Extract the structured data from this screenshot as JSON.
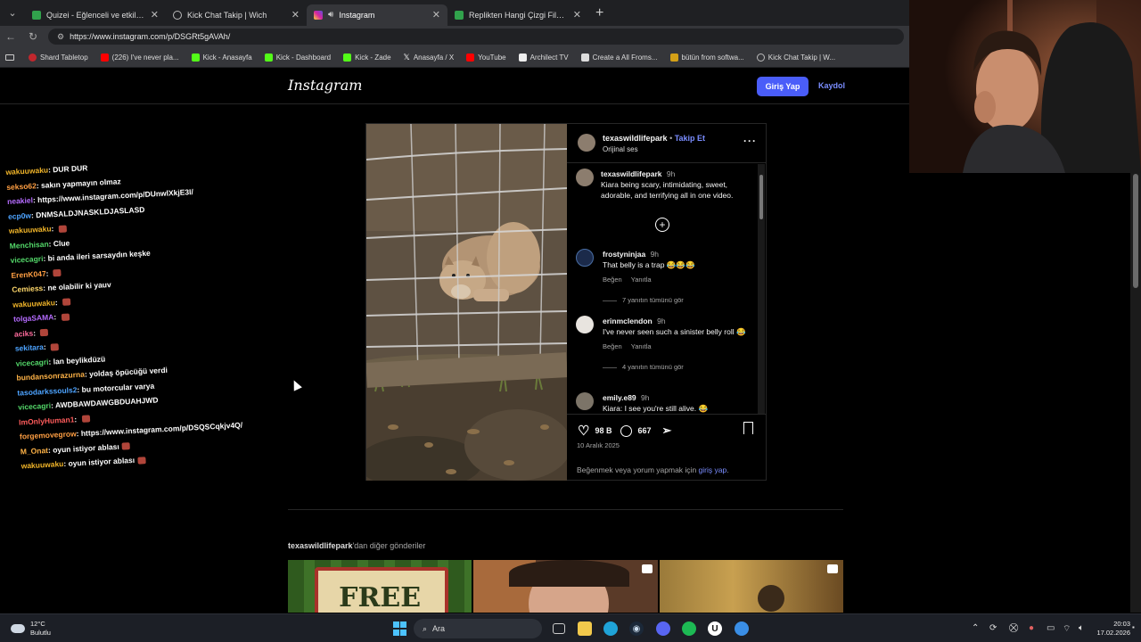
{
  "browser": {
    "tabs": [
      {
        "title": "Quizei - Eğlenceli ve etkileşimli qu",
        "color": "#31a24c"
      },
      {
        "title": "Kick Chat Takip | Wich",
        "color": "#888888"
      },
      {
        "title": "Instagram",
        "color": "#d6249f",
        "active": true
      },
      {
        "title": "Replikten Hangi Çizgi Film Olduğu",
        "color": "#31a24c"
      }
    ],
    "url": "https://www.instagram.com/p/DSGRt5gAVAh/",
    "bookmarks": [
      {
        "label": "Shard Tabletop",
        "color": "#c1272d"
      },
      {
        "label": "(226) I've never pla...",
        "color": "#ff0000"
      },
      {
        "label": "Kick - Anasayfa",
        "color": "#53fc18"
      },
      {
        "label": "Kick - Dashboard",
        "color": "#53fc18"
      },
      {
        "label": "Kick - Zade",
        "color": "#53fc18"
      },
      {
        "label": "Anasayfa / X",
        "color": "#ffffff"
      },
      {
        "label": "YouTube",
        "color": "#ff0000"
      },
      {
        "label": "Archilect TV",
        "color": "#eeeeee"
      },
      {
        "label": "Create a All Froms...",
        "color": "#dddddd"
      },
      {
        "label": "bütün from softwa...",
        "color": "#d4a017"
      },
      {
        "label": "Kick Chat Takip | W...",
        "color": "#aaaaaa"
      }
    ]
  },
  "instagram": {
    "logo": "Instagram",
    "login_label": "Giriş Yap",
    "signup_label": "Kaydol",
    "post": {
      "username": "texaswildlifepark",
      "follow": "Takip Et",
      "audio": "Orijinal ses",
      "caption_user": "texaswildlifepark",
      "caption_time": "9h",
      "caption": "Kiara being scary, intimidating, sweet, adorable, and terrifying all in one video.",
      "comments": [
        {
          "user": "frostyninjaa",
          "time": "9h",
          "text": "That belly is a trap 😂😂😂",
          "like": "Beğen",
          "reply": "Yanıtla",
          "view_replies": "7 yanıtın tümünü gör"
        },
        {
          "user": "erinmclendon",
          "time": "9h",
          "text": "I've never seen such a sinister belly roll 😂",
          "like": "Beğen",
          "reply": "Yanıtla",
          "view_replies": "4 yanıtın tümünü gör"
        },
        {
          "user": "emily.e89",
          "time": "9h",
          "text": "Kiara: I see you're still alive. 😂"
        }
      ],
      "likes": "98 B",
      "comment_count": "667",
      "date": "10 Aralık 2025",
      "login_prompt": "Beğenmek veya yorum yapmak için",
      "login_link": "giriş yap",
      "login_tail": "."
    },
    "more_posts_user": "texaswildlifepark",
    "more_posts_suffix": "'dan diğer gönderiler",
    "thumb_text": "FREE"
  },
  "chat": [
    {
      "user": "wakuuwaku",
      "color": "#f0b429",
      "msg": "DUR DUR"
    },
    {
      "user": "sekso62",
      "color": "#ff9f43",
      "msg": "sakın yapmayın olmaz"
    },
    {
      "user": "neakiel",
      "color": "#b56bff",
      "msg": "https://www.instagram.com/p/DUnwlXkjE3I/"
    },
    {
      "user": "ecp0w",
      "color": "#4da3ff",
      "msg": "DNMSALDJNASKLDJASLASD"
    },
    {
      "user": "wakuuwaku",
      "color": "#f0b429",
      "msg": "",
      "emote": true
    },
    {
      "user": "Menchisan",
      "color": "#53d769",
      "msg": "Clue"
    },
    {
      "user": "vicecagri",
      "color": "#53d769",
      "msg": "bi anda ileri sarsaydın keşke"
    },
    {
      "user": "ErenK047",
      "color": "#ff9f43",
      "msg": "",
      "emote": true
    },
    {
      "user": "Cemiess",
      "color": "#ffd86b",
      "msg": "ne olabilir ki yauv"
    },
    {
      "user": "wakuuwaku",
      "color": "#f0b429",
      "msg": "",
      "emote": true
    },
    {
      "user": "tolgaSAMA",
      "color": "#b56bff",
      "msg": "",
      "emote": true
    },
    {
      "user": "aciks",
      "color": "#ff6b9d",
      "msg": "",
      "emote": true
    },
    {
      "user": "sekitara",
      "color": "#4da3ff",
      "msg": "",
      "emote": true
    },
    {
      "user": "vicecagri",
      "color": "#53d769",
      "msg": "lan beylikdüzü"
    },
    {
      "user": "bundansonrazurna",
      "color": "#ffb347",
      "msg": "yoldaş öpücüğü verdi"
    },
    {
      "user": "tasodarkssouls2",
      "color": "#4da3ff",
      "msg": "bu motorcular varya"
    },
    {
      "user": "vicecagri",
      "color": "#53d769",
      "msg": "AWDBAWDAWGBDUAHJWD"
    },
    {
      "user": "ImOnlyHuman1",
      "color": "#ff5c5c",
      "msg": "",
      "emote": true
    },
    {
      "user": "forgemovegrow",
      "color": "#ff9f43",
      "msg": "https://www.instagram.com/p/DSQSCqkjv4Q/"
    },
    {
      "user": "M_Onat",
      "color": "#ffb347",
      "msg": "oyun istiyor ablası",
      "emote": true
    },
    {
      "user": "wakuuwaku",
      "color": "#f0b429",
      "msg": "oyun istiyor ablası",
      "emote": true
    }
  ],
  "taskbar": {
    "temp": "12°C",
    "weather": "Bulutlu",
    "search": "Ara",
    "time": "20:03",
    "date": "17.02.2026"
  }
}
